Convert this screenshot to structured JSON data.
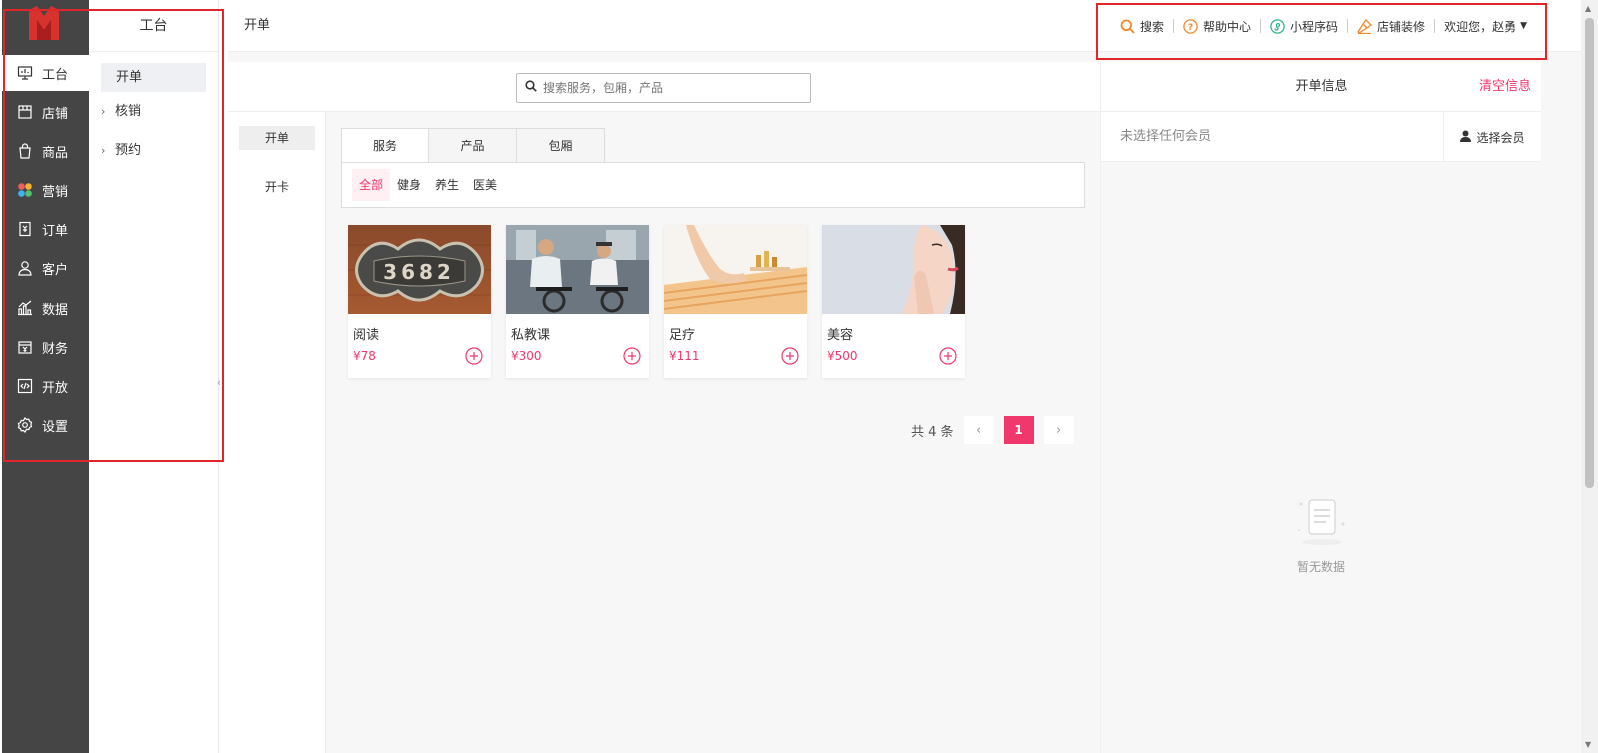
{
  "sidebar": {
    "items": [
      {
        "label": "工台",
        "icon": "dashboard-icon"
      },
      {
        "label": "店铺",
        "icon": "store-icon"
      },
      {
        "label": "商品",
        "icon": "bag-icon"
      },
      {
        "label": "营销",
        "icon": "marketing-icon"
      },
      {
        "label": "订单",
        "icon": "order-icon"
      },
      {
        "label": "客户",
        "icon": "user-icon"
      },
      {
        "label": "数据",
        "icon": "chart-icon"
      },
      {
        "label": "财务",
        "icon": "finance-icon"
      },
      {
        "label": "开放",
        "icon": "code-icon"
      },
      {
        "label": "设置",
        "icon": "gear-icon"
      }
    ]
  },
  "submenu": {
    "title": "工台",
    "items": [
      {
        "label": "开单"
      },
      {
        "label": "核销"
      },
      {
        "label": "预约"
      }
    ]
  },
  "header": {
    "breadcrumb": "开单",
    "links": {
      "search": "搜索",
      "help": "帮助中心",
      "miniprogram": "小程序码",
      "decorate": "店铺装修",
      "welcome": "欢迎您，赵勇"
    }
  },
  "search": {
    "placeholder": "搜索服务，包厢，产品"
  },
  "left_tabs": [
    {
      "label": "开单"
    },
    {
      "label": "开卡"
    }
  ],
  "category_tabs": [
    {
      "label": "服务"
    },
    {
      "label": "产品"
    },
    {
      "label": "包厢"
    }
  ],
  "filters": [
    {
      "label": "全部"
    },
    {
      "label": "健身"
    },
    {
      "label": "养生"
    },
    {
      "label": "医美"
    }
  ],
  "products": [
    {
      "name": "阅读",
      "price": "¥78"
    },
    {
      "name": "私教课",
      "price": "¥300"
    },
    {
      "name": "足疗",
      "price": "¥111"
    },
    {
      "name": "美容",
      "price": "¥500"
    }
  ],
  "pagination": {
    "total": "共 4 条",
    "current": "1"
  },
  "order_panel": {
    "title": "开单信息",
    "clear": "清空信息",
    "no_member": "未选择任何会员",
    "select_member": "选择会员",
    "empty": "暂无数据"
  },
  "colors": {
    "accent": "#f0386c",
    "rail": "#454545",
    "annotation": "#e0262a",
    "icon_orange": "#f08a2c",
    "icon_green": "#2fb58a"
  }
}
